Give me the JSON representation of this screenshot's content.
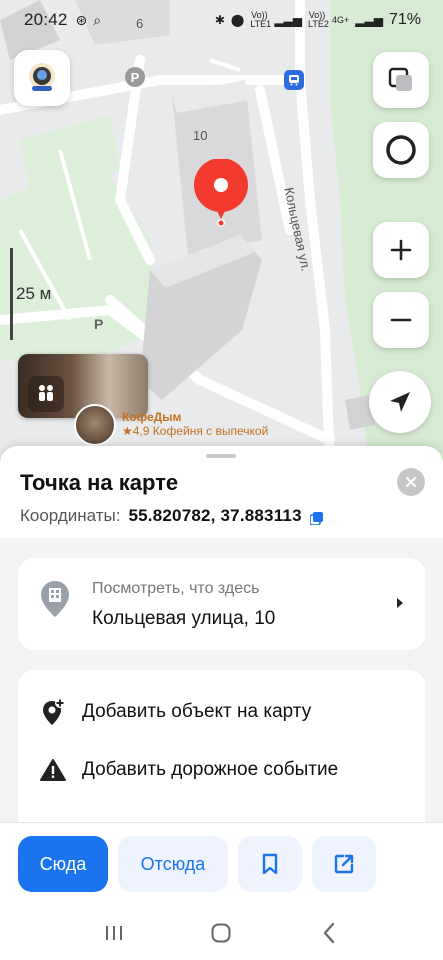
{
  "status_bar": {
    "time": "20:42",
    "net_1": "Vo)) LTE1",
    "net_2": "Vo)) LTE2",
    "net_4g": "4G+",
    "battery": "71%"
  },
  "map": {
    "house_number": "10",
    "house_number_2": "6",
    "street_name": "Кольцевая ул.",
    "scale_label": "25 м",
    "parking_label": "P",
    "poi": {
      "name": "КофеДым",
      "rating_line": "★4,9 Кофейня с выпечкой"
    }
  },
  "sheet": {
    "title": "Точка на карте",
    "coords_label": "Координаты:",
    "coords_value": "55.820782, 37.883113",
    "address_card": {
      "subtitle": "Посмотреть, что здесь",
      "address": "Кольцевая улица, 10"
    },
    "actions": [
      {
        "label": "Добавить объект на карту",
        "icon": "map-pin-plus-icon"
      },
      {
        "label": "Добавить дорожное событие",
        "icon": "warning-icon"
      }
    ]
  },
  "bottom_buttons": {
    "here_label": "Сюда",
    "from_label": "Отсюда",
    "bookmark_icon": "bookmark-icon",
    "share_icon": "share-icon"
  },
  "colors": {
    "accent": "#1a74ee",
    "pin": "#f23a2f",
    "poi_text": "#c5701c"
  }
}
